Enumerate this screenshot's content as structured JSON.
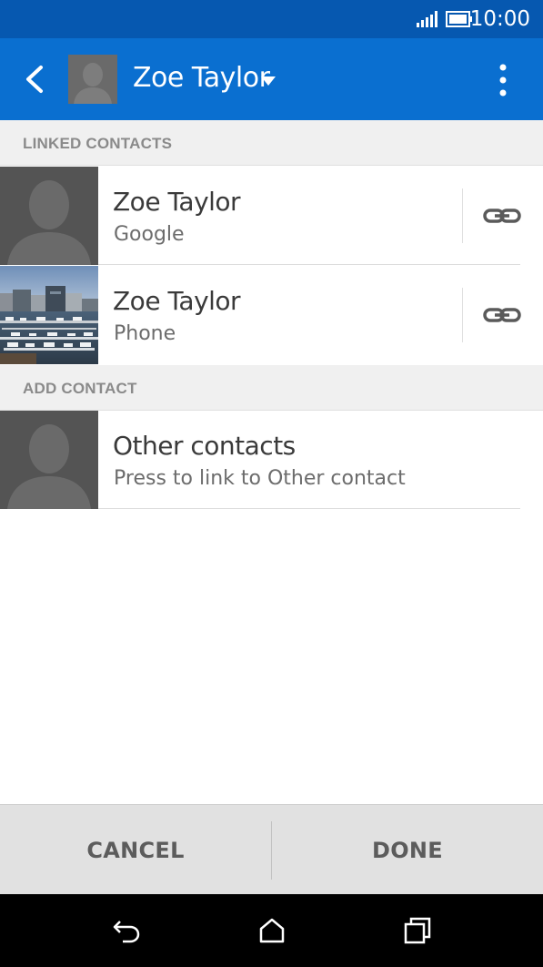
{
  "status_bar": {
    "time": "10:00",
    "icons": [
      "signal-icon",
      "battery-icon"
    ]
  },
  "app_bar": {
    "title": "Zoe Taylor",
    "icons": [
      "back-icon",
      "caret-down-icon",
      "overflow-menu-icon"
    ]
  },
  "sections": {
    "linked_header": "LINKED CONTACTS",
    "add_header": "ADD CONTACT"
  },
  "linked_contacts": [
    {
      "name": "Zoe Taylor",
      "source": "Google"
    },
    {
      "name": "Zoe Taylor",
      "source": "Phone"
    }
  ],
  "other_contacts": {
    "title": "Other contacts",
    "subtitle": "Press to link to Other contact"
  },
  "footer": {
    "cancel_label": "CANCEL",
    "done_label": "DONE"
  },
  "nav_bar": {
    "icons": [
      "back-nav-icon",
      "home-icon",
      "recent-apps-icon"
    ]
  },
  "colors": {
    "status_bar": "#0658b0",
    "app_bar": "#0a6fd0",
    "footer": "#e1e1e1",
    "section": "#f0f0f0"
  }
}
